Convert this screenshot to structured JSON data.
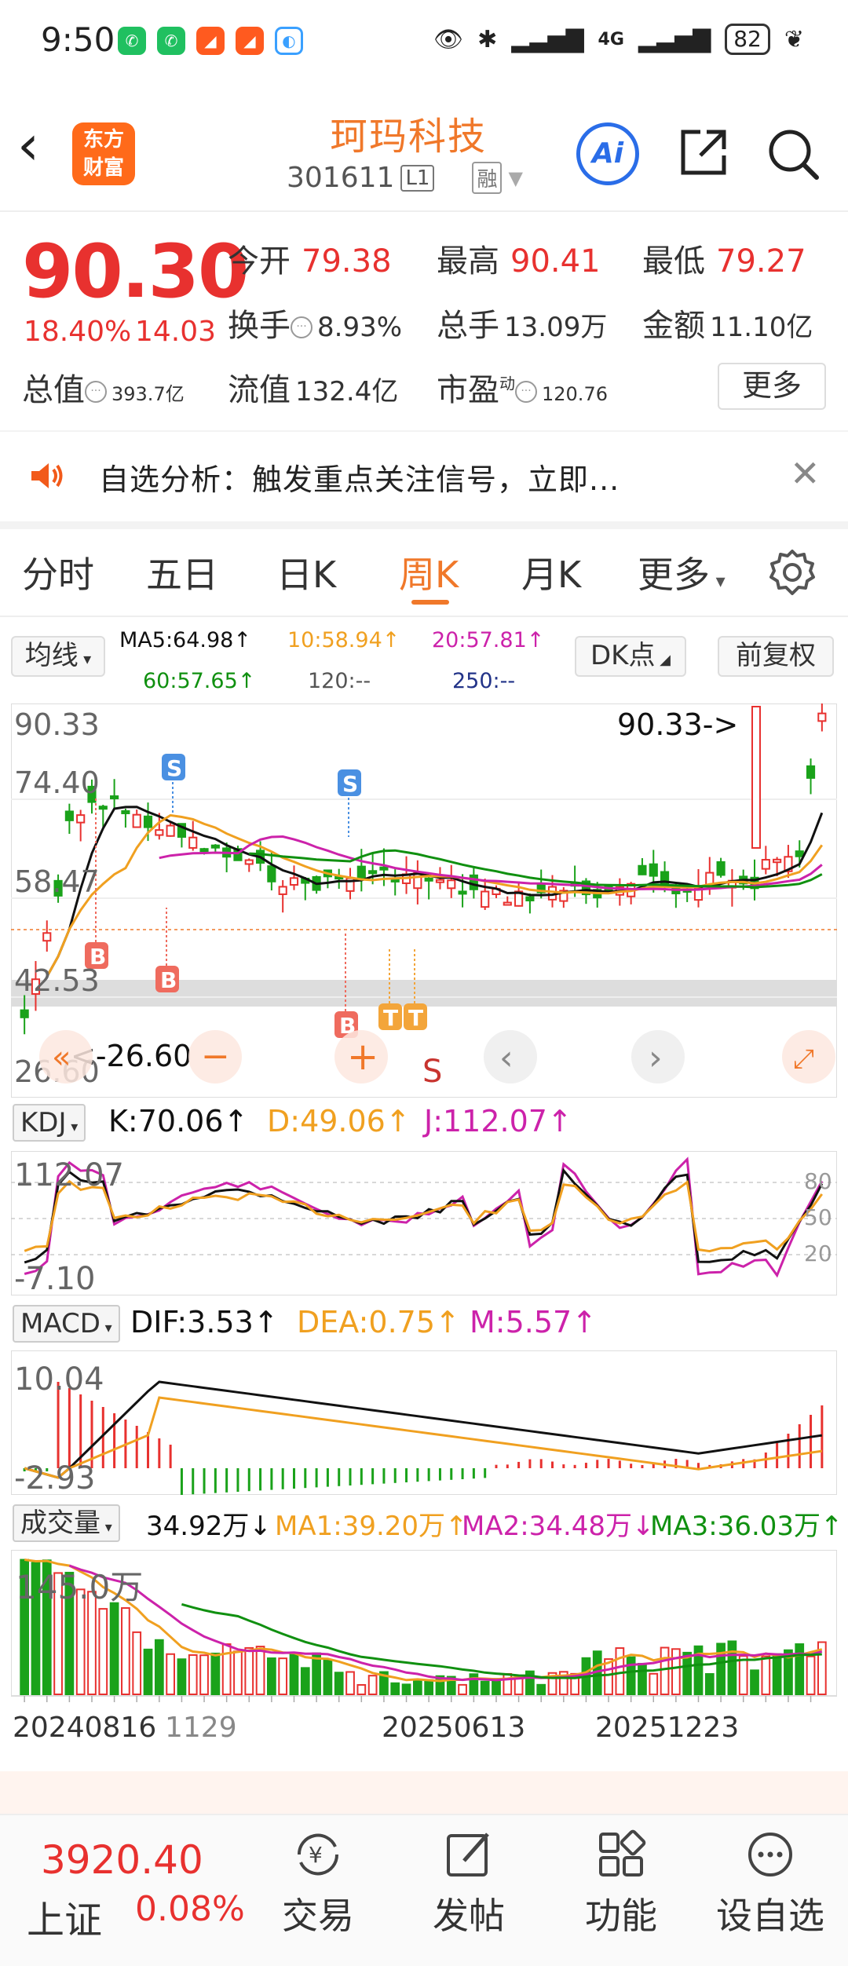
{
  "status": {
    "time": "9:50",
    "battery": "82",
    "network": "4G"
  },
  "header": {
    "title": "珂玛科技",
    "code": "301611",
    "tag1": "L1",
    "tag2": "融",
    "logo": "东方\n财富",
    "ai": "Ai"
  },
  "quote": {
    "price": "90.30",
    "change_pct": "18.40%",
    "change": "14.03",
    "open_label": "今开",
    "open": "79.38",
    "high_label": "最高",
    "high": "90.41",
    "low_label": "最低",
    "low": "79.27",
    "turnover_label": "换手",
    "turnover": "8.93%",
    "volume_label": "总手",
    "volume": "13.09万",
    "amount_label": "金额",
    "amount": "11.10亿",
    "mktcap_label": "总值",
    "mktcap": "393.7亿",
    "float_label": "流值",
    "float": "132.4亿",
    "pe_label": "市盈",
    "pe_sup": "动",
    "pe": "120.76",
    "more": "更多"
  },
  "notice": {
    "text": "自选分析：触发重点关注信号，立即..."
  },
  "tabs": [
    {
      "label": "分时"
    },
    {
      "label": "五日"
    },
    {
      "label": "日K"
    },
    {
      "label": "周K"
    },
    {
      "label": "月K"
    },
    {
      "label": "更多"
    }
  ],
  "ma": {
    "selector": "均线",
    "dk": "DK点",
    "fq": "前复权",
    "ma5": "MA5:64.98↑",
    "ma10": "10:58.94↑",
    "ma20": "20:57.81↑",
    "ma60": "60:57.65↑",
    "ma120": "120:--",
    "ma250": "250:--"
  },
  "kline": {
    "y_labels": [
      "90.33",
      "74.40",
      "58.47",
      "42.53",
      "26.60"
    ],
    "max_note": "90.33->",
    "min_note": "<-26.60",
    "s_label": "S",
    "marks": [
      "S",
      "S",
      "B",
      "B",
      "B",
      "T",
      "T"
    ]
  },
  "kdj": {
    "selector": "KDJ",
    "k": "K:70.06↑",
    "d": "D:49.06↑",
    "j": "J:112.07↑",
    "y_top": "112.07",
    "y_bot": "-7.10",
    "levels": [
      "80",
      "50",
      "20"
    ]
  },
  "macd": {
    "selector": "MACD",
    "dif": "DIF:3.53↑",
    "dea": "DEA:0.75↑",
    "m": "M:5.57↑",
    "y_top": "10.04",
    "y_bot": "-2.93"
  },
  "vol": {
    "selector": "成交量",
    "v": "34.92万↓",
    "ma1": "MA1:39.20万↑",
    "ma2": "MA2:34.48万↓",
    "ma3": "MA3:36.03万↑",
    "y_top": "145.0万"
  },
  "dates": [
    "20240816",
    "1129",
    "20250613",
    "20251223"
  ],
  "bottom": {
    "index_value": "3920.40",
    "index_name": "上证",
    "index_change": "0.08%",
    "nav": [
      {
        "label": "交易"
      },
      {
        "label": "发帖"
      },
      {
        "label": "功能"
      },
      {
        "label": "设自选"
      }
    ]
  },
  "colors": {
    "up": "#e8312f",
    "down": "#1aa21a",
    "accent": "#f0782a",
    "ma5": "#111111",
    "ma10": "#f0a020",
    "ma20": "#cc22aa",
    "ma60": "#109010"
  }
}
